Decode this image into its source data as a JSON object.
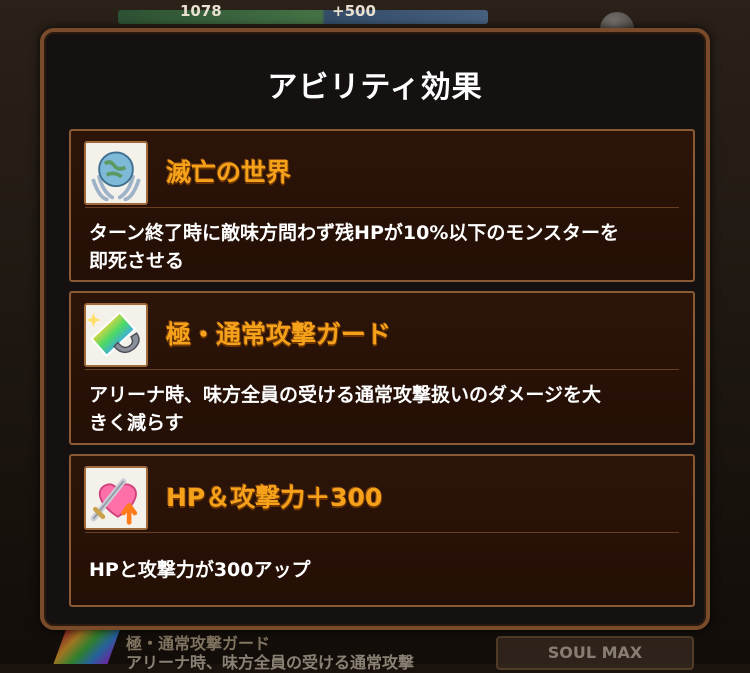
{
  "background": {
    "hp_value": "1078",
    "cost_value": "+500",
    "bottom_line1": "極・通常攻撃ガード",
    "bottom_line2": "アリーナ時、味方全員の受ける通常攻撃",
    "soul_button": "SOUL MAX"
  },
  "modal": {
    "title": "アビリティ効果",
    "abilities": [
      {
        "name": "滅亡の世界",
        "icon": "planet-tentacles-icon",
        "description_line1": "ターン終了時に敵味方問わず残HPが10%以下のモンスターを",
        "description_line2": "即死させる"
      },
      {
        "name": "極・通常攻撃ガード",
        "icon": "rainbow-shield-icon",
        "description_line1": "アリーナ時、味方全員の受ける通常攻撃扱いのダメージを大",
        "description_line2": "きく減らす"
      },
      {
        "name": "HP＆攻撃力＋300",
        "icon": "heart-sword-up-icon",
        "description_line1": "HPと攻撃力が300アップ",
        "description_line2": ""
      }
    ]
  },
  "colors": {
    "ability_name": "#f5a21a",
    "card_border": "#8a5a34",
    "modal_border": "#7a4b2a"
  }
}
